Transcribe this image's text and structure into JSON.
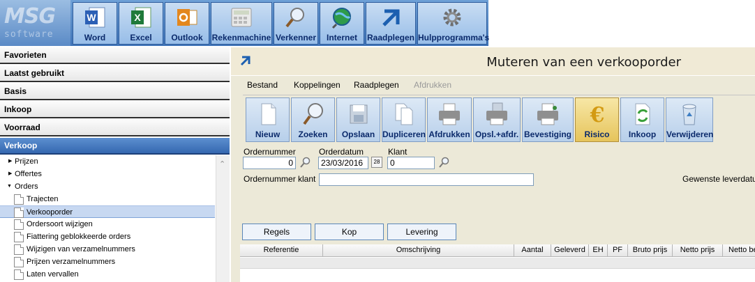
{
  "launcher": {
    "logo_top": "MSG",
    "logo_bottom": "software",
    "items": [
      {
        "label": "Word",
        "icon": "word-icon"
      },
      {
        "label": "Excel",
        "icon": "excel-icon"
      },
      {
        "label": "Outlook",
        "icon": "outlook-icon"
      },
      {
        "label": "Rekenmachine",
        "icon": "calculator-icon"
      },
      {
        "label": "Verkenner",
        "icon": "explorer-icon"
      },
      {
        "label": "Internet",
        "icon": "globe-icon"
      },
      {
        "label": "Raadplegen",
        "icon": "arrow-icon"
      },
      {
        "label": "Hulpprogramma's",
        "icon": "gear-icon"
      }
    ]
  },
  "nav": {
    "sections": [
      "Favorieten",
      "Laatst gebruikt",
      "Basis",
      "Inkoop",
      "Voorraad",
      "Verkoop"
    ],
    "active_section": "Verkoop",
    "items": [
      {
        "label": "Prijzen",
        "type": "collapsed"
      },
      {
        "label": "Offertes",
        "type": "collapsed"
      },
      {
        "label": "Orders",
        "type": "expanded"
      },
      {
        "label": "Trajecten",
        "type": "doc"
      },
      {
        "label": "Verkooporder",
        "type": "doc",
        "selected": true
      },
      {
        "label": "Ordersoort wijzigen",
        "type": "doc"
      },
      {
        "label": "Fiattering geblokkeerde orders",
        "type": "doc"
      },
      {
        "label": "Wijzigen van verzamelnummers",
        "type": "doc"
      },
      {
        "label": "Prijzen verzamelnummers",
        "type": "doc"
      },
      {
        "label": "Laten vervallen",
        "type": "doc"
      }
    ]
  },
  "window": {
    "title": "Muteren van een verkooporder"
  },
  "menu": {
    "bestand": "Bestand",
    "koppelingen": "Koppelingen",
    "raadplegen": "Raadplegen",
    "afdrukken": "Afdrukken"
  },
  "toolbar": {
    "buttons": [
      {
        "label": "Nieuw",
        "icon": "new-document-icon"
      },
      {
        "label": "Zoeken",
        "icon": "search-icon"
      },
      {
        "label": "Opslaan",
        "icon": "save-icon"
      },
      {
        "label": "Dupliceren",
        "icon": "duplicate-icon"
      },
      {
        "label": "Afdrukken",
        "icon": "printer-icon"
      },
      {
        "label": "Opsl.+afdr.",
        "icon": "save-print-icon"
      },
      {
        "label": "Bevestiging",
        "icon": "confirmation-printer-icon"
      },
      {
        "label": "Risico",
        "icon": "euro-icon",
        "active": true
      },
      {
        "label": "Inkoop",
        "icon": "refresh-document-icon"
      },
      {
        "label": "Verwijderen",
        "icon": "recycle-bin-icon"
      }
    ]
  },
  "form": {
    "ordernummer_label": "Ordernummer",
    "ordernummer_value": "0",
    "orderdatum_label": "Orderdatum",
    "orderdatum_value": "23/03/2016",
    "calendar_badge": "28",
    "klant_label": "Klant",
    "klant_value": "0",
    "ordernummer_klant_label": "Ordernummer klant",
    "ordernummer_klant_value": "",
    "gewenste_leverdatum_label": "Gewenste leverdatum"
  },
  "tabs": {
    "regels": "Regels",
    "kop": "Kop",
    "levering": "Levering"
  },
  "grid": {
    "columns": [
      "Referentie",
      "Omschrijving",
      "Aantal",
      "Geleverd",
      "EH",
      "PF",
      "Bruto prijs",
      "Netto prijs",
      "Netto be"
    ]
  },
  "colors": {
    "accent": "#3568b0",
    "toolbar_button": "#b7cfea",
    "active_button": "#e6c45b"
  }
}
